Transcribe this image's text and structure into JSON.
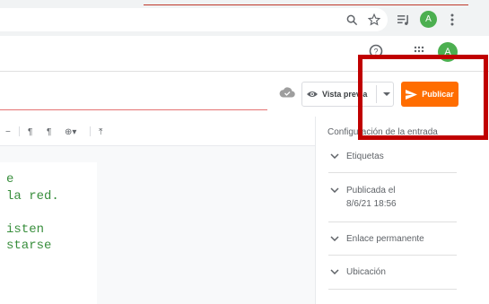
{
  "browser": {
    "icons": [
      "search-icon",
      "star-icon",
      "queue-music-icon",
      "profile-avatar",
      "more-vert-icon"
    ],
    "profile_initial": "A"
  },
  "header": {
    "icons": [
      "help-icon",
      "apps-grid-icon"
    ],
    "account_initial": "A"
  },
  "title_bar": {
    "save_status_icon": "cloud-done-icon",
    "preview_label": "Vista previa",
    "publish_label": "Publicar"
  },
  "toolbar": {
    "items": [
      "−",
      "¶",
      "¶",
      "⊕▾",
      "⤒"
    ]
  },
  "editor": {
    "code_lines": [
      "e",
      "la red.",
      "",
      "isten",
      "starse"
    ]
  },
  "sidebar": {
    "title": "Configuración de la entrada",
    "sections": [
      {
        "label": "Etiquetas"
      },
      {
        "label": "Publicada el",
        "value": "8/6/21 18:56"
      },
      {
        "label": "Enlace permanente"
      },
      {
        "label": "Ubicación"
      }
    ]
  },
  "colors": {
    "accent": "#ff6d00",
    "annotation": "#c00000",
    "code_text": "#388e3c",
    "avatar": "#4caf50"
  }
}
